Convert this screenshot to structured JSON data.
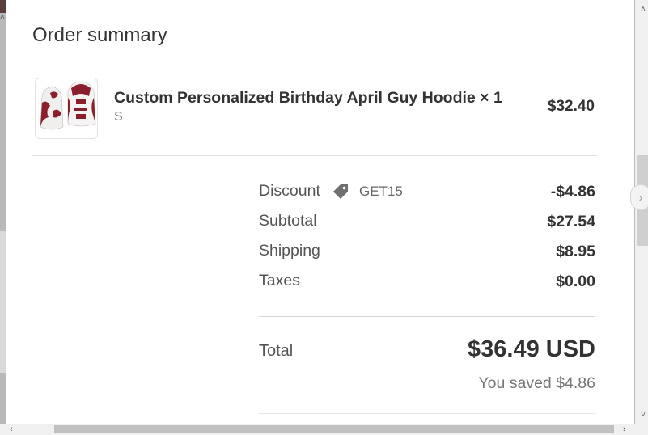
{
  "order_summary": {
    "title": "Order summary",
    "item": {
      "name": "Custom Personalized Birthday April Guy Hoodie × 1",
      "variant": "S",
      "price": "$32.40",
      "thumbnail_icon": "hoodie-thumbnail"
    },
    "discount": {
      "label": "Discount",
      "code": "GET15",
      "value": "-$4.86",
      "icon": "tag-icon"
    },
    "subtotal": {
      "label": "Subtotal",
      "value": "$27.54"
    },
    "shipping": {
      "label": "Shipping",
      "value": "$8.95"
    },
    "taxes": {
      "label": "Taxes",
      "value": "$0.00"
    },
    "total": {
      "label": "Total",
      "value": "$36.49 USD"
    },
    "saved": "You saved $4.86"
  },
  "colors": {
    "text_dark": "#333333",
    "text_muted": "#777777",
    "hoodie_maroon": "#8b1f2b"
  }
}
